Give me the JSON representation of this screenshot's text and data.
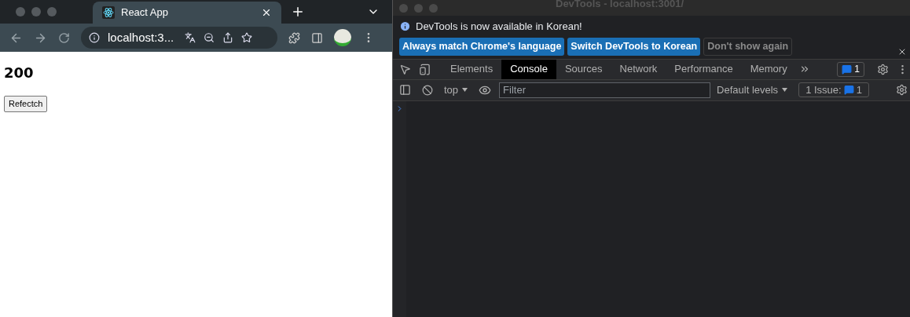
{
  "browser": {
    "tab": {
      "title": "React App"
    },
    "address": "localhost:3...",
    "page": {
      "heading": "200",
      "button": "Refectch"
    }
  },
  "devtools": {
    "window_title": "DevTools - localhost:3001/",
    "infobar": {
      "message": "DevTools is now available in Korean!",
      "buttons": [
        {
          "label": "Always match Chrome's language",
          "kind": "primary"
        },
        {
          "label": "Switch DevTools to Korean",
          "kind": "primary"
        },
        {
          "label": "Don't show again",
          "kind": "secondary"
        }
      ]
    },
    "tabs": [
      {
        "label": "Elements",
        "selected": false
      },
      {
        "label": "Console",
        "selected": true
      },
      {
        "label": "Sources",
        "selected": false
      },
      {
        "label": "Network",
        "selected": false
      },
      {
        "label": "Performance",
        "selected": false
      },
      {
        "label": "Memory",
        "selected": false
      }
    ],
    "message_count": "1",
    "console_toolbar": {
      "context": "top",
      "filter_placeholder": "Filter",
      "levels": "Default levels",
      "issues_label": "1 Issue:",
      "issues_count": "1"
    }
  }
}
